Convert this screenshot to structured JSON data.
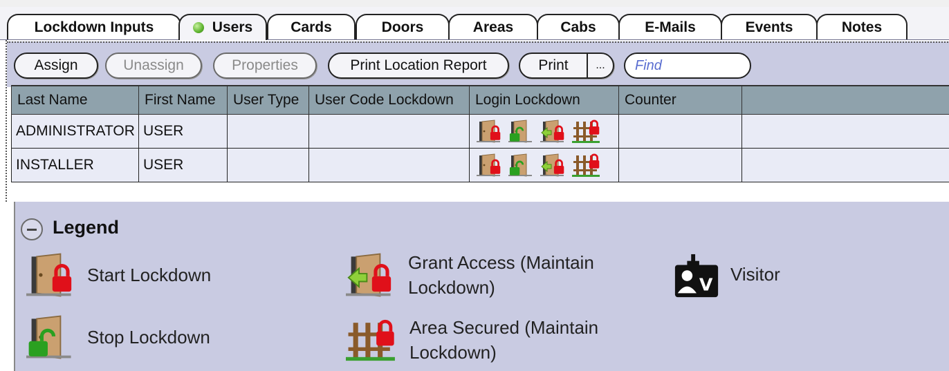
{
  "tabs": [
    {
      "label": "Lockdown Inputs",
      "active": false
    },
    {
      "label": "Users",
      "active": true,
      "status": "green"
    },
    {
      "label": "Cards",
      "active": false
    },
    {
      "label": "Doors",
      "active": false
    },
    {
      "label": "Areas",
      "active": false
    },
    {
      "label": "Cabs",
      "active": false
    },
    {
      "label": "E-Mails",
      "active": false
    },
    {
      "label": "Events",
      "active": false
    },
    {
      "label": "Notes",
      "active": false
    }
  ],
  "toolbar": {
    "assign": "Assign",
    "unassign": "Unassign",
    "properties": "Properties",
    "print_location_report": "Print Location Report",
    "print": "Print",
    "print_more": "...",
    "find_placeholder": "Find"
  },
  "grid": {
    "columns": [
      "Last Name",
      "First Name",
      "User Type",
      "User Code Lockdown",
      "Login Lockdown",
      "Counter",
      ""
    ],
    "rows": [
      {
        "last_name": "ADMINISTRATOR",
        "first_name": "USER",
        "user_type": "",
        "user_code_lockdown": "",
        "login_lockdown_icons": [
          "start-lockdown",
          "stop-lockdown",
          "grant-access",
          "area-secured"
        ],
        "counter": ""
      },
      {
        "last_name": "INSTALLER",
        "first_name": "USER",
        "user_type": "",
        "user_code_lockdown": "",
        "login_lockdown_icons": [
          "start-lockdown",
          "stop-lockdown",
          "grant-access",
          "area-secured"
        ],
        "counter": ""
      }
    ]
  },
  "legend": {
    "title": "Legend",
    "items": [
      {
        "icon": "start-lockdown",
        "label": "Start Lockdown"
      },
      {
        "icon": "stop-lockdown",
        "label": "Stop Lockdown"
      },
      {
        "icon": "grant-access",
        "label_line1": "Grant Access (Maintain",
        "label_line2": "Lockdown)"
      },
      {
        "icon": "area-secured",
        "label_line1": "Area Secured (Maintain",
        "label_line2": "Lockdown)"
      },
      {
        "icon": "visitor",
        "label": "Visitor"
      }
    ]
  },
  "colors": {
    "toolbar_bg": "#c9cbe2",
    "header_bg": "#8fa2ac",
    "row_bg": "#e9ebf6",
    "lock_red": "#e0101a",
    "status_green": "#5db32e"
  }
}
